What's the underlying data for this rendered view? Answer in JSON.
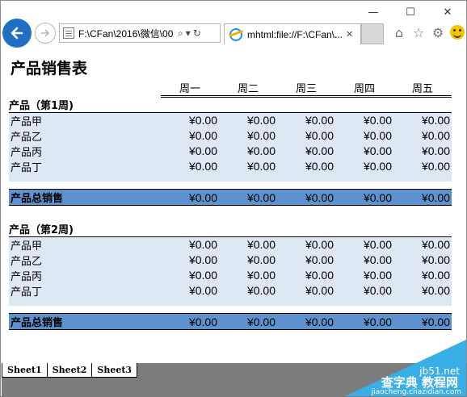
{
  "browser": {
    "address": "F:\\CFan\\2016\\微信\\00",
    "tab_title": "mhtml:file://F:\\CFan\\...",
    "caption_min": "—",
    "caption_max": "☐",
    "caption_close": "✕"
  },
  "sheet": {
    "title": "产品销售表",
    "days": [
      "周一",
      "周二",
      "周三",
      "周四",
      "周五"
    ],
    "sections": [
      {
        "heading": "产品（第1周)",
        "items": [
          {
            "name": "产品甲",
            "values": [
              "¥0.00",
              "¥0.00",
              "¥0.00",
              "¥0.00",
              "¥0.00"
            ]
          },
          {
            "name": "产品乙",
            "values": [
              "¥0.00",
              "¥0.00",
              "¥0.00",
              "¥0.00",
              "¥0.00"
            ]
          },
          {
            "name": "产品丙",
            "values": [
              "¥0.00",
              "¥0.00",
              "¥0.00",
              "¥0.00",
              "¥0.00"
            ]
          },
          {
            "name": "产品丁",
            "values": [
              "¥0.00",
              "¥0.00",
              "¥0.00",
              "¥0.00",
              "¥0.00"
            ]
          }
        ],
        "total_label": "产品总销售",
        "totals": [
          "¥0.00",
          "¥0.00",
          "¥0.00",
          "¥0.00",
          "¥0.00"
        ]
      },
      {
        "heading": "产品（第2周)",
        "items": [
          {
            "name": "产品甲",
            "values": [
              "¥0.00",
              "¥0.00",
              "¥0.00",
              "¥0.00",
              "¥0.00"
            ]
          },
          {
            "name": "产品乙",
            "values": [
              "¥0.00",
              "¥0.00",
              "¥0.00",
              "¥0.00",
              "¥0.00"
            ]
          },
          {
            "name": "产品丙",
            "values": [
              "¥0.00",
              "¥0.00",
              "¥0.00",
              "¥0.00",
              "¥0.00"
            ]
          },
          {
            "name": "产品丁",
            "values": [
              "¥0.00",
              "¥0.00",
              "¥0.00",
              "¥0.00",
              "¥0.00"
            ]
          }
        ],
        "total_label": "产品总销售",
        "totals": [
          "¥0.00",
          "¥0.00",
          "¥0.00",
          "¥0.00",
          "¥0.00"
        ]
      }
    ]
  },
  "sheet_tabs": [
    "Sheet1",
    "Sheet2",
    "Sheet3"
  ],
  "watermark": {
    "line1": "jb51.net",
    "line2": "查字典 教程网",
    "line3": "jiaocheng.chazidian.com"
  }
}
